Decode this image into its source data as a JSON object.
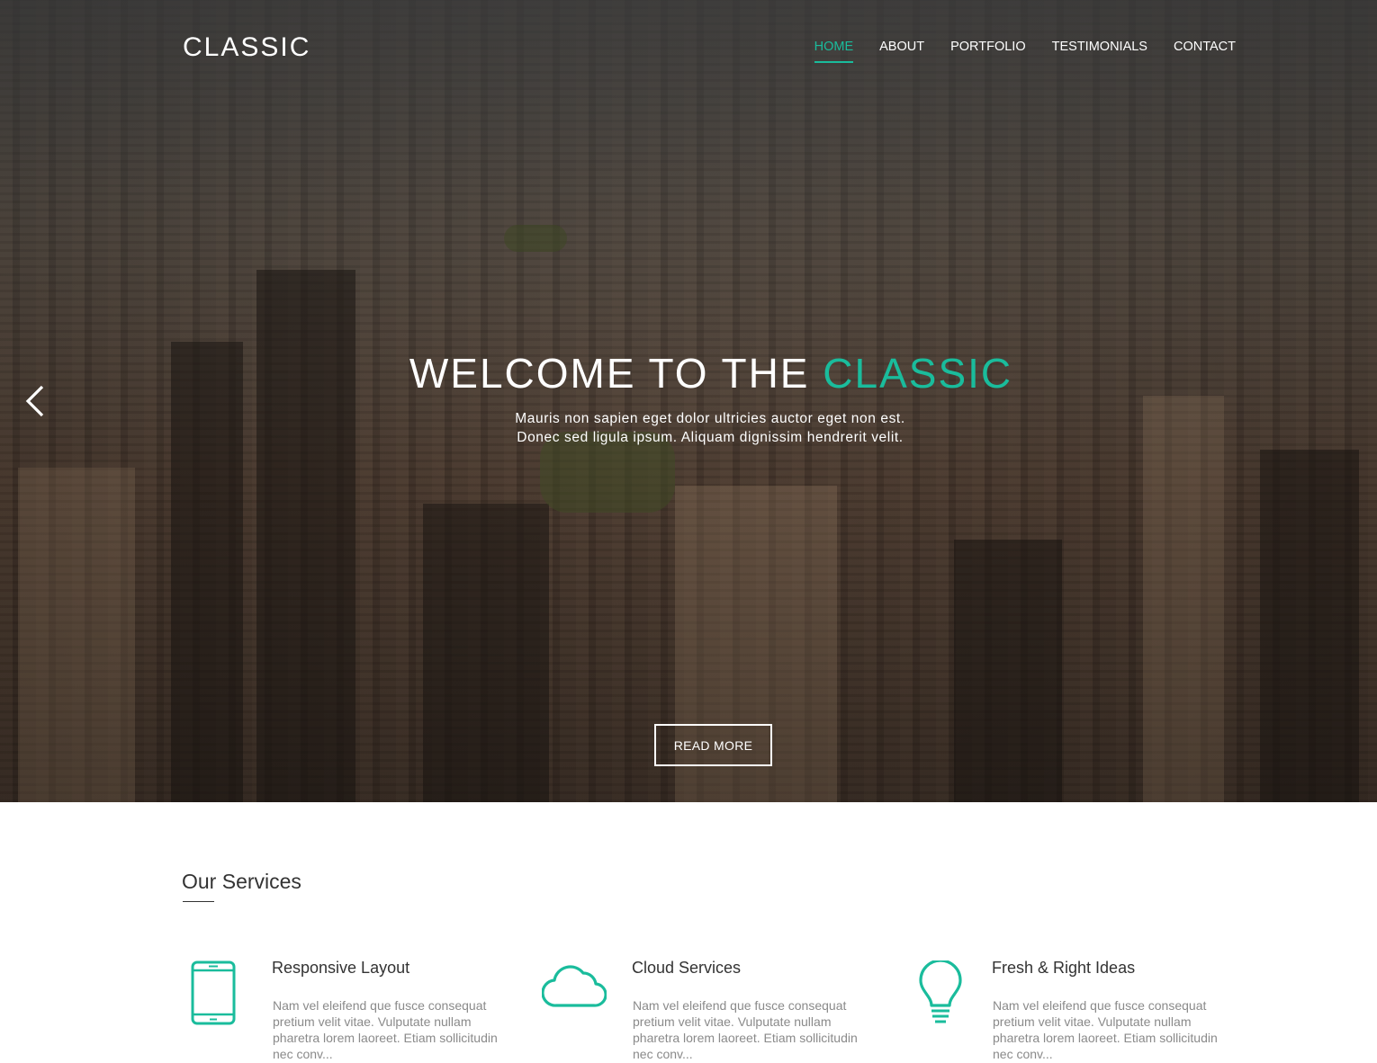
{
  "brand": {
    "logo": "CLASSIC",
    "accent_color": "#1abc9c"
  },
  "nav": {
    "items": [
      {
        "label": "HOME",
        "active": true
      },
      {
        "label": "ABOUT",
        "active": false
      },
      {
        "label": "PORTFOLIO",
        "active": false
      },
      {
        "label": "TESTIMONIALS",
        "active": false
      },
      {
        "label": "CONTACT",
        "active": false
      }
    ]
  },
  "hero": {
    "title_prefix": "WELCOME TO THE ",
    "title_accent": "CLASSIC",
    "subtitle_line1": "Mauris non sapien eget dolor ultricies auctor eget non est.",
    "subtitle_line2": "Donec sed ligula ipsum. Aliquam dignissim hendrerit velit.",
    "button_label": "READ MORE",
    "prev_icon": "chevron-left-icon"
  },
  "services": {
    "title": "Our Services",
    "items": [
      {
        "icon": "tablet-icon",
        "title": "Responsive Layout",
        "text": "Nam vel eleifend que fusce consequat pretium velit vitae. Vulputate nullam pharetra lorem laoreet. Etiam sollicitudin nec conv..."
      },
      {
        "icon": "cloud-icon",
        "title": "Cloud Services",
        "text": "Nam vel eleifend que fusce consequat pretium velit vitae. Vulputate nullam pharetra lorem laoreet. Etiam sollicitudin nec conv..."
      },
      {
        "icon": "lightbulb-icon",
        "title": "Fresh & Right Ideas",
        "text": "Nam vel eleifend que fusce consequat pretium velit vitae. Vulputate nullam pharetra lorem laoreet. Etiam sollicitudin nec conv..."
      }
    ]
  }
}
